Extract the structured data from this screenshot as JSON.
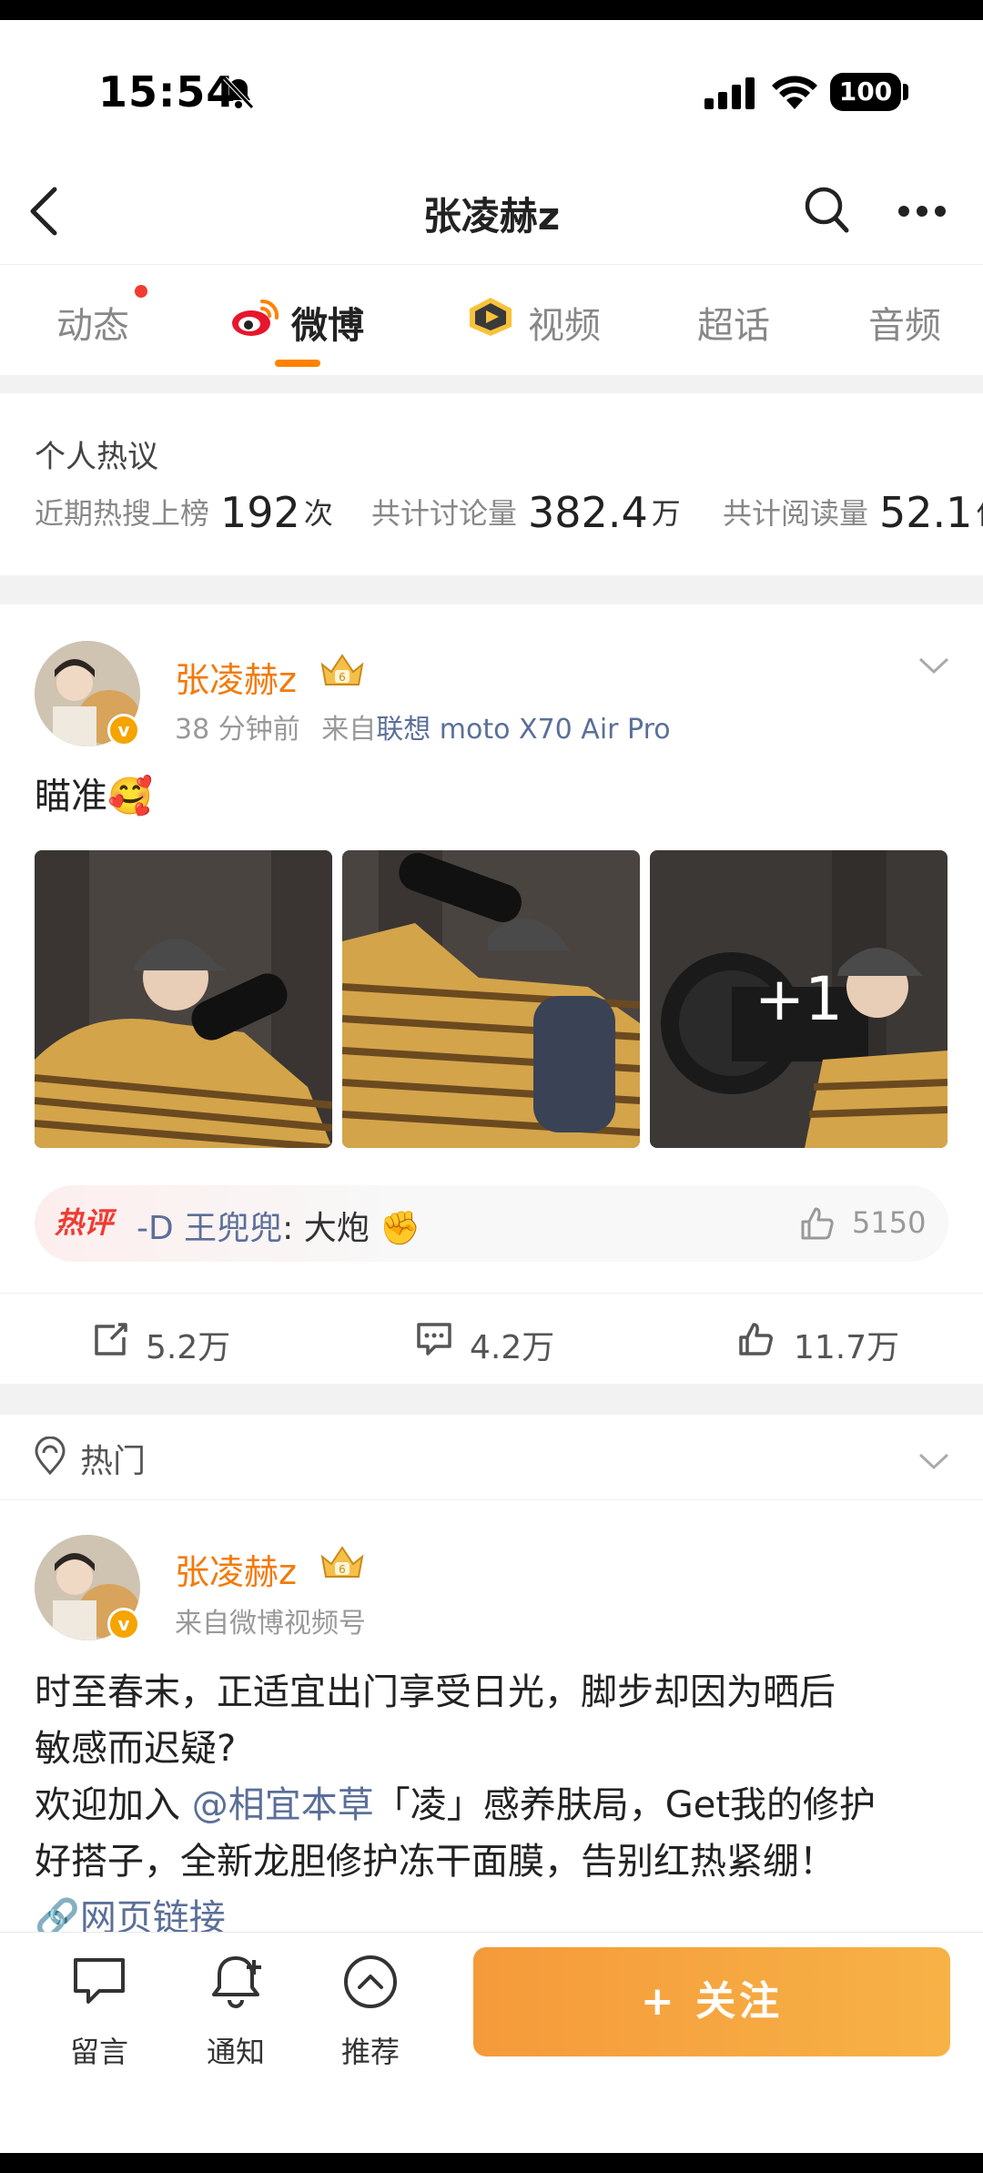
{
  "status_bar": {
    "time": "15:54",
    "battery": "100"
  },
  "header": {
    "title": "张凌赫z"
  },
  "tabs": [
    {
      "label": "动态"
    },
    {
      "label": "微博"
    },
    {
      "label": "视频"
    },
    {
      "label": "超话"
    },
    {
      "label": "音频"
    }
  ],
  "hot_discussion": {
    "title": "个人热议",
    "stats": [
      {
        "label": "近期热搜上榜",
        "value": "192",
        "unit": "次"
      },
      {
        "label": "共计讨论量",
        "value": "382.4",
        "unit": "万"
      },
      {
        "label": "共计阅读量",
        "value": "52.1",
        "unit": "亿"
      }
    ]
  },
  "post1": {
    "author": "张凌赫z",
    "time": "38 分钟前",
    "source_prefix": "来自",
    "device": "联想 moto X70 Air Pro",
    "text": "瞄准🥰",
    "more_photos": "+1",
    "hot_comment": {
      "label": "热评",
      "user": "-D 王兜兜",
      "text": ": 大炮 ✊",
      "likes": "5150"
    },
    "actions": {
      "reposts": "5.2万",
      "comments": "4.2万",
      "likes": "11.7万"
    }
  },
  "hot_row": {
    "label": "热门"
  },
  "post2": {
    "author": "张凌赫z",
    "source": "来自微博视频号",
    "line1": "时至春末，正适宜出门享受日光，脚步却因为晒后",
    "line2": "敏感而迟疑?",
    "line3_pre": "欢迎加入 ",
    "line3_mention": "@相宜本草",
    "line3_post": "「凌」感养肤局，Get我的修护",
    "line4": "好搭子，全新龙胆修护冻干面膜，告别红热紧绷！",
    "line5": "网页链接"
  },
  "bottom_bar": {
    "message": "留言",
    "notify": "通知",
    "recommend": "推荐",
    "follow": "+ 关注"
  },
  "colors": {
    "accent": "#ff8200",
    "username": "#f27a0b",
    "link": "#5b6f99"
  }
}
